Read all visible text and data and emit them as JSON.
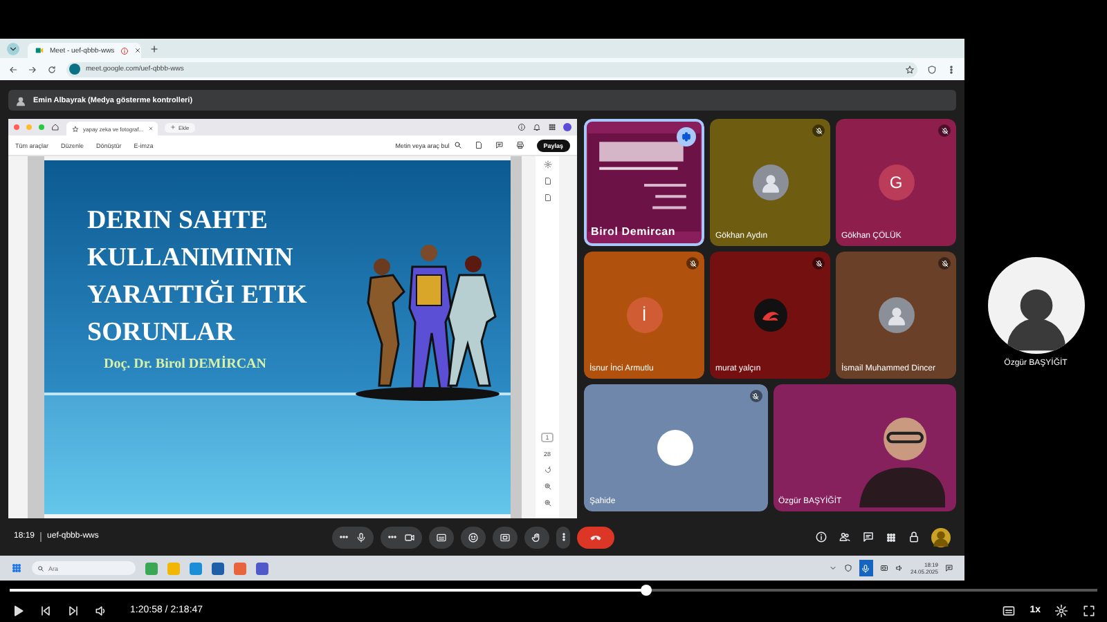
{
  "browser": {
    "tab_title": "Meet - uef-qbbb-wws",
    "url": "meet.google.com/uef-qbbb-wws"
  },
  "presenter_bar": {
    "text": "Emin Albayrak (Medya gösterme kontrolleri)"
  },
  "shared_screen": {
    "tab_title": "yapay zeka ve fotograf...",
    "new_tab_label": "Ekle",
    "menu": [
      "Tüm araçlar",
      "Düzenle",
      "Dönüştür",
      "E-imza"
    ],
    "search": {
      "placeholder": "Metin veya araç bul"
    },
    "share_button": "Paylaş",
    "page_current": "1",
    "page_total": "28",
    "slide": {
      "title": "DERIN SAHTE KULLANIMININ YARATTIĞI ETIK SORUNLAR",
      "author": "Doç. Dr. Birol DEMİRCAN"
    }
  },
  "tiles": [
    {
      "name": "Birol Demircan",
      "kind": "screen",
      "color": "#8a1d5c",
      "speaking": true,
      "muted": false
    },
    {
      "name": "Gökhan Aydın",
      "kind": "photo",
      "color": "#6e5c10",
      "speaking": false,
      "muted": true
    },
    {
      "name": "Gökhan ÇÖLÜK",
      "kind": "letter",
      "letter": "G",
      "color": "#8e1e4c",
      "speaking": false,
      "muted": true
    },
    {
      "name": "İsnur İnci Armutlu",
      "kind": "letter",
      "letter": "İ",
      "color": "#b0520e",
      "speaking": false,
      "muted": true
    },
    {
      "name": "murat yalçın",
      "kind": "logo",
      "color": "#741010",
      "speaking": false,
      "muted": true
    },
    {
      "name": "İsmail Muhammed Dincer",
      "kind": "photo",
      "color": "#6a4029",
      "speaking": false,
      "muted": true
    },
    {
      "name": "Şahide",
      "kind": "blank",
      "color": "#6f87aa",
      "speaking": false,
      "muted": true
    },
    {
      "name": "Özgür BAŞYİĞİT",
      "kind": "camera",
      "color": "#86215e",
      "speaking": false,
      "muted": false
    }
  ],
  "meeting_bar": {
    "time": "18:19",
    "code": "uef-qbbb-wws"
  },
  "self_view": {
    "name": "Özgür BAŞYİĞİT"
  },
  "taskbar": {
    "search": {
      "placeholder": "Ara"
    },
    "time": "18:19",
    "date": "24.05.2025"
  },
  "player": {
    "progress": {
      "level": 0.585
    },
    "time": "1:20:58 / 2:18:47",
    "speed": "1x"
  }
}
